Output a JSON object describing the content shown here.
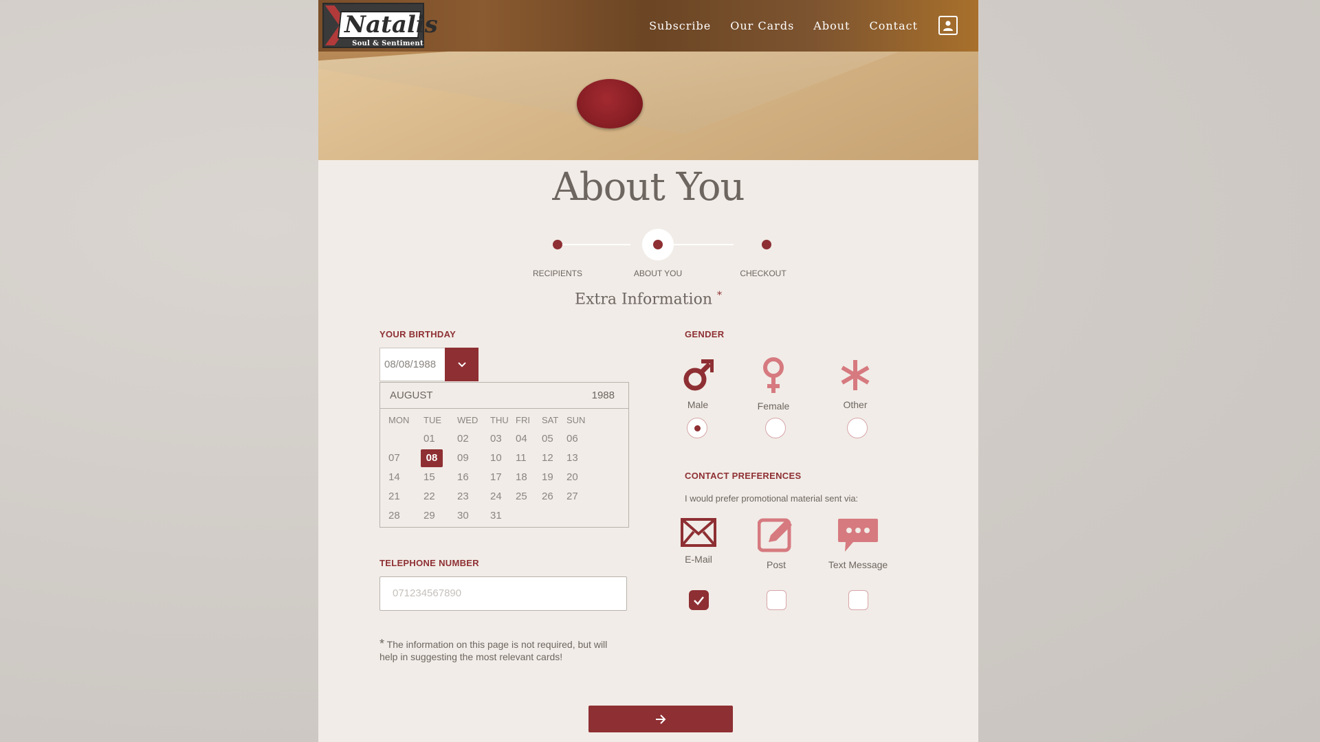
{
  "header": {
    "logo_text": "Natalis",
    "logo_subtitle": "Soul & Sentiment",
    "nav": [
      "Subscribe",
      "Our Cards",
      "About",
      "Contact"
    ]
  },
  "page_title": "About You",
  "stepper": {
    "steps": [
      "RECIPIENTS",
      "ABOUT YOU",
      "CHECKOUT"
    ],
    "active_index": 1
  },
  "section_title": "Extra Information",
  "section_title_marker": "*",
  "birthday": {
    "label": "YOUR BIRTHDAY",
    "value": "08/08/1988",
    "calendar": {
      "month": "AUGUST",
      "year": "1988",
      "day_names": [
        "MON",
        "TUE",
        "WED",
        "THU",
        "FRI",
        "SAT",
        "SUN"
      ],
      "weeks": [
        [
          "",
          "01",
          "02",
          "03",
          "04",
          "05",
          "06"
        ],
        [
          "07",
          "08",
          "09",
          "10",
          "11",
          "12",
          "13"
        ],
        [
          "14",
          "15",
          "16",
          "17",
          "18",
          "19",
          "20"
        ],
        [
          "21",
          "22",
          "23",
          "24",
          "25",
          "26",
          "27"
        ],
        [
          "28",
          "29",
          "30",
          "31",
          "",
          "",
          ""
        ]
      ],
      "selected": "08"
    }
  },
  "telephone": {
    "label": "TELEPHONE NUMBER",
    "placeholder": "071234567890",
    "value": ""
  },
  "note": {
    "marker": "*",
    "text": "The information on this page is not required, but will help in suggesting the most relevant cards!"
  },
  "gender": {
    "label": "GENDER",
    "options": [
      {
        "label": "Male",
        "icon": "male-icon",
        "selected": true
      },
      {
        "label": "Female",
        "icon": "female-icon",
        "selected": false
      },
      {
        "label": "Other",
        "icon": "asterisk-icon",
        "selected": false
      }
    ]
  },
  "contact": {
    "label": "CONTACT PREFERENCES",
    "prompt": "I would prefer promotional material sent via:",
    "options": [
      {
        "label": "E-Mail",
        "icon": "envelope-icon",
        "checked": true
      },
      {
        "label": "Post",
        "icon": "edit-icon",
        "checked": false
      },
      {
        "label": "Text Message",
        "icon": "chat-icon",
        "checked": false
      }
    ]
  },
  "next_button_icon": "arrow-right-icon",
  "colors": {
    "accent": "#8e2f33",
    "accent_light": "#d67a80",
    "text": "#6d6560",
    "panel": "#f1ece7"
  }
}
